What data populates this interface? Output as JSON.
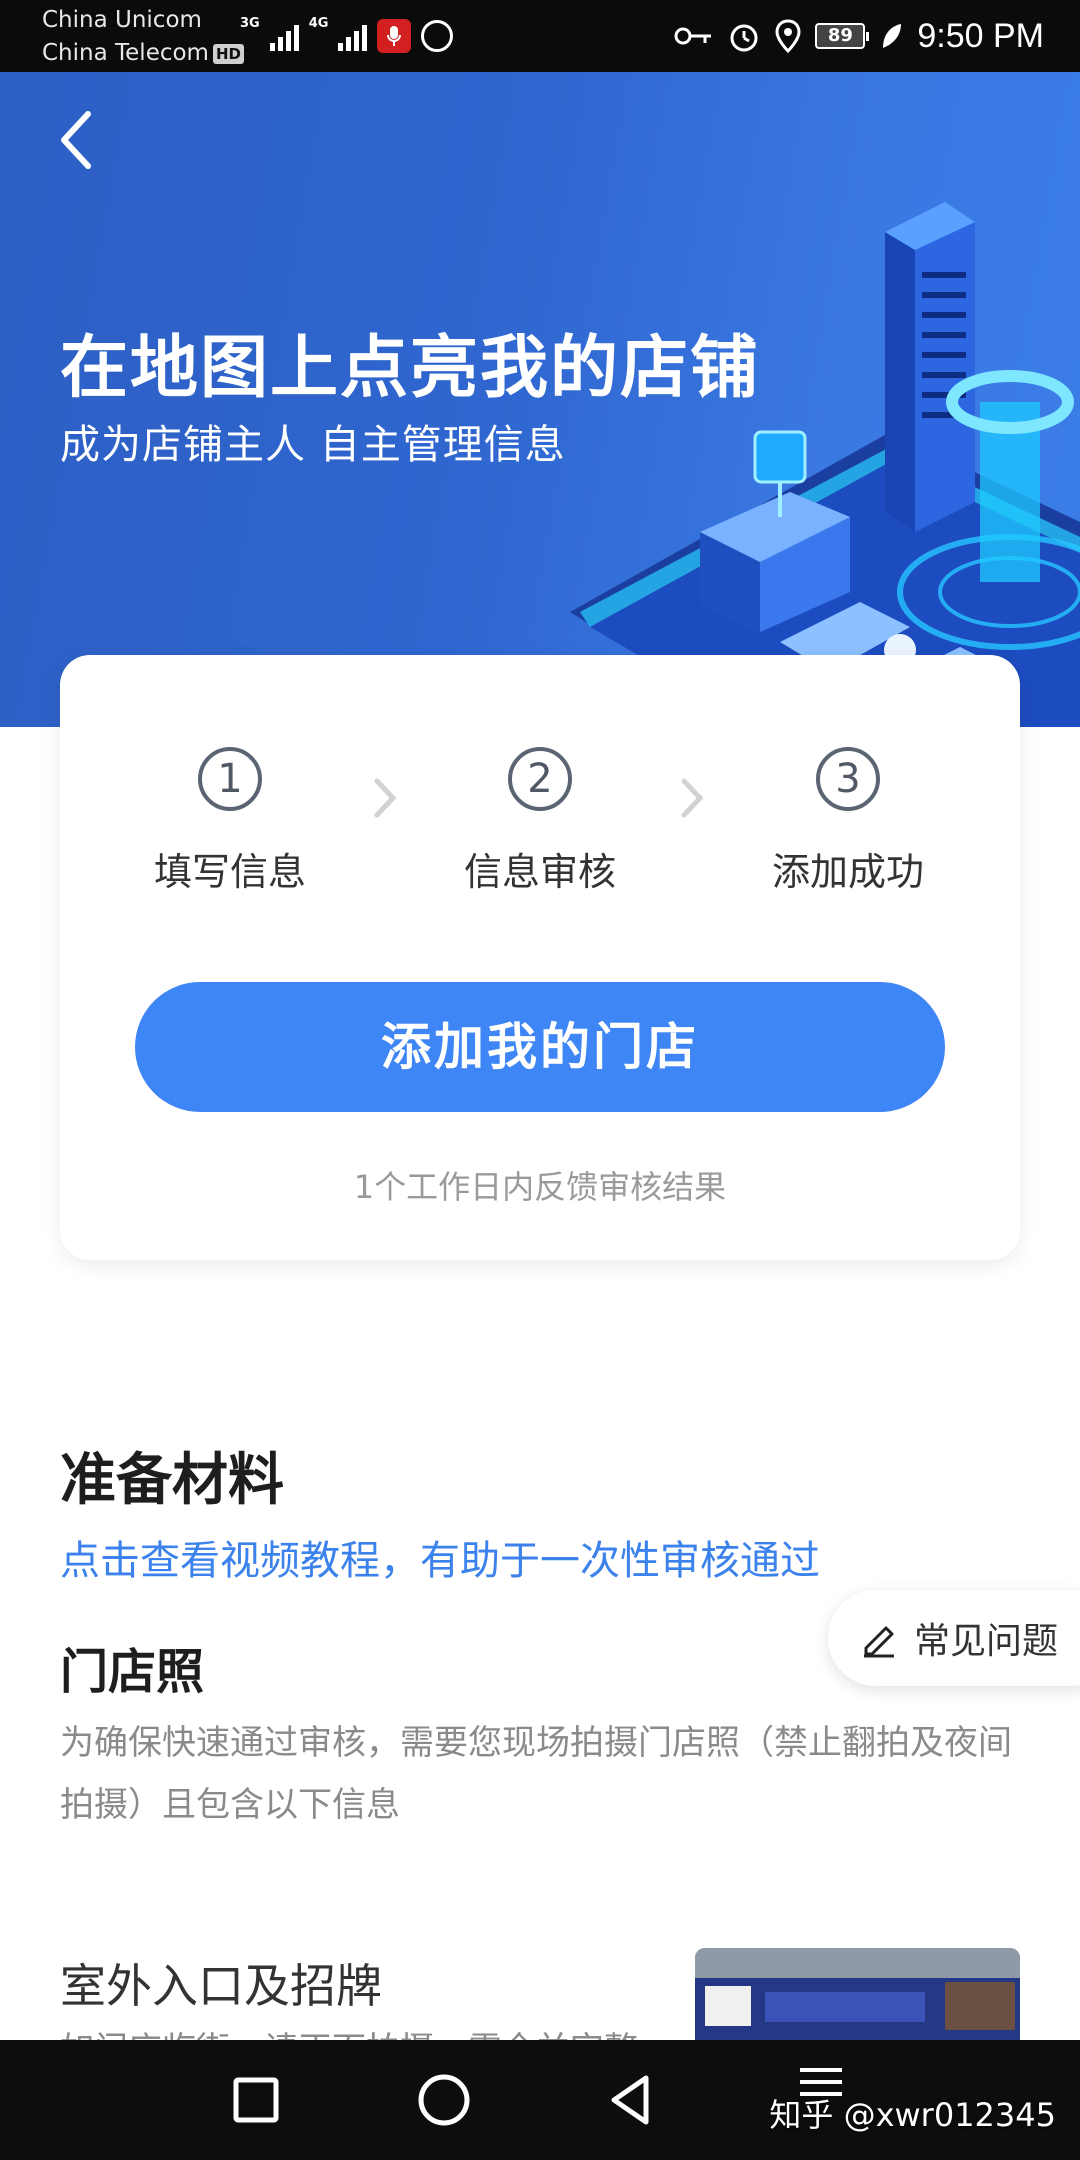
{
  "status_bar": {
    "carrier1": "China Unicom",
    "carrier2": "China Telecom",
    "hd_badge": "HD",
    "net1": "3G",
    "net2": "4G",
    "battery": "89",
    "time": "9:50 PM"
  },
  "hero": {
    "title": "在地图上点亮我的店铺",
    "subtitle": "成为店铺主人  自主管理信息"
  },
  "steps": [
    {
      "num": "1",
      "label": "填写信息"
    },
    {
      "num": "2",
      "label": "信息审核"
    },
    {
      "num": "3",
      "label": "添加成功"
    }
  ],
  "card": {
    "button_label": "添加我的门店",
    "note": "1个工作日内反馈审核结果"
  },
  "materials": {
    "title": "准备材料",
    "video_link": "点击查看视频教程，有助于一次性审核通过",
    "photo_title": "门店照",
    "photo_desc": "为确保快速通过审核，需要您现场拍摄门店照（禁止翻拍及夜间拍摄）且包含以下信息",
    "faq_label": "常见问题",
    "item_title": "室外入口及招牌",
    "item_desc": "如门店临街，请正面拍摄，需全并完整"
  },
  "watermark": "知乎 @xwr012345",
  "colors": {
    "accent": "#3e86f5",
    "hero_bg": "#2f66cf",
    "link": "#3c82ec"
  }
}
